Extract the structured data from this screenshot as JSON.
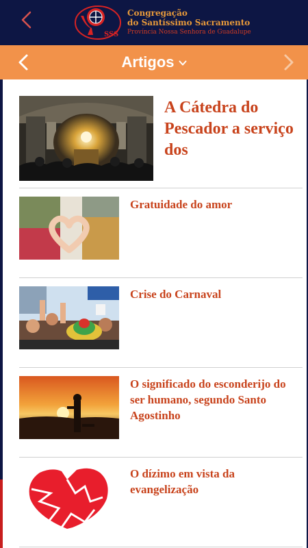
{
  "header": {
    "org_line1": "Congregação",
    "org_line2": "do Santíssimo Sacramento",
    "org_line3": "Província Nossa Senhora de Guadalupe",
    "logo_text": "SSS",
    "background_color": "#0d1644",
    "back_icon": "chevron-left-icon"
  },
  "category_bar": {
    "title": "Artigos",
    "background_color": "#f2924a",
    "prev_icon": "chevron-left-icon",
    "next_icon": "chevron-right-icon",
    "dropdown_icon": "chevron-down-icon"
  },
  "featured": {
    "title": "A Cátedra do Pescador a serviço dos",
    "image": "cathedral-interior-image"
  },
  "articles": [
    {
      "title": "Gratuidade do amor",
      "image": "hands-heart-image"
    },
    {
      "title": "Crise do Carnaval",
      "image": "carnival-crowd-image"
    },
    {
      "title": "O significado do esconderijo do ser humano, segundo Santo Agostinho",
      "image": "sunset-silhouette-image"
    },
    {
      "title": "O dízimo em vista da evangelização",
      "image": "broken-heart-image"
    }
  ],
  "colors": {
    "title_color": "#c8431c",
    "divider": "#cfcfcf"
  }
}
